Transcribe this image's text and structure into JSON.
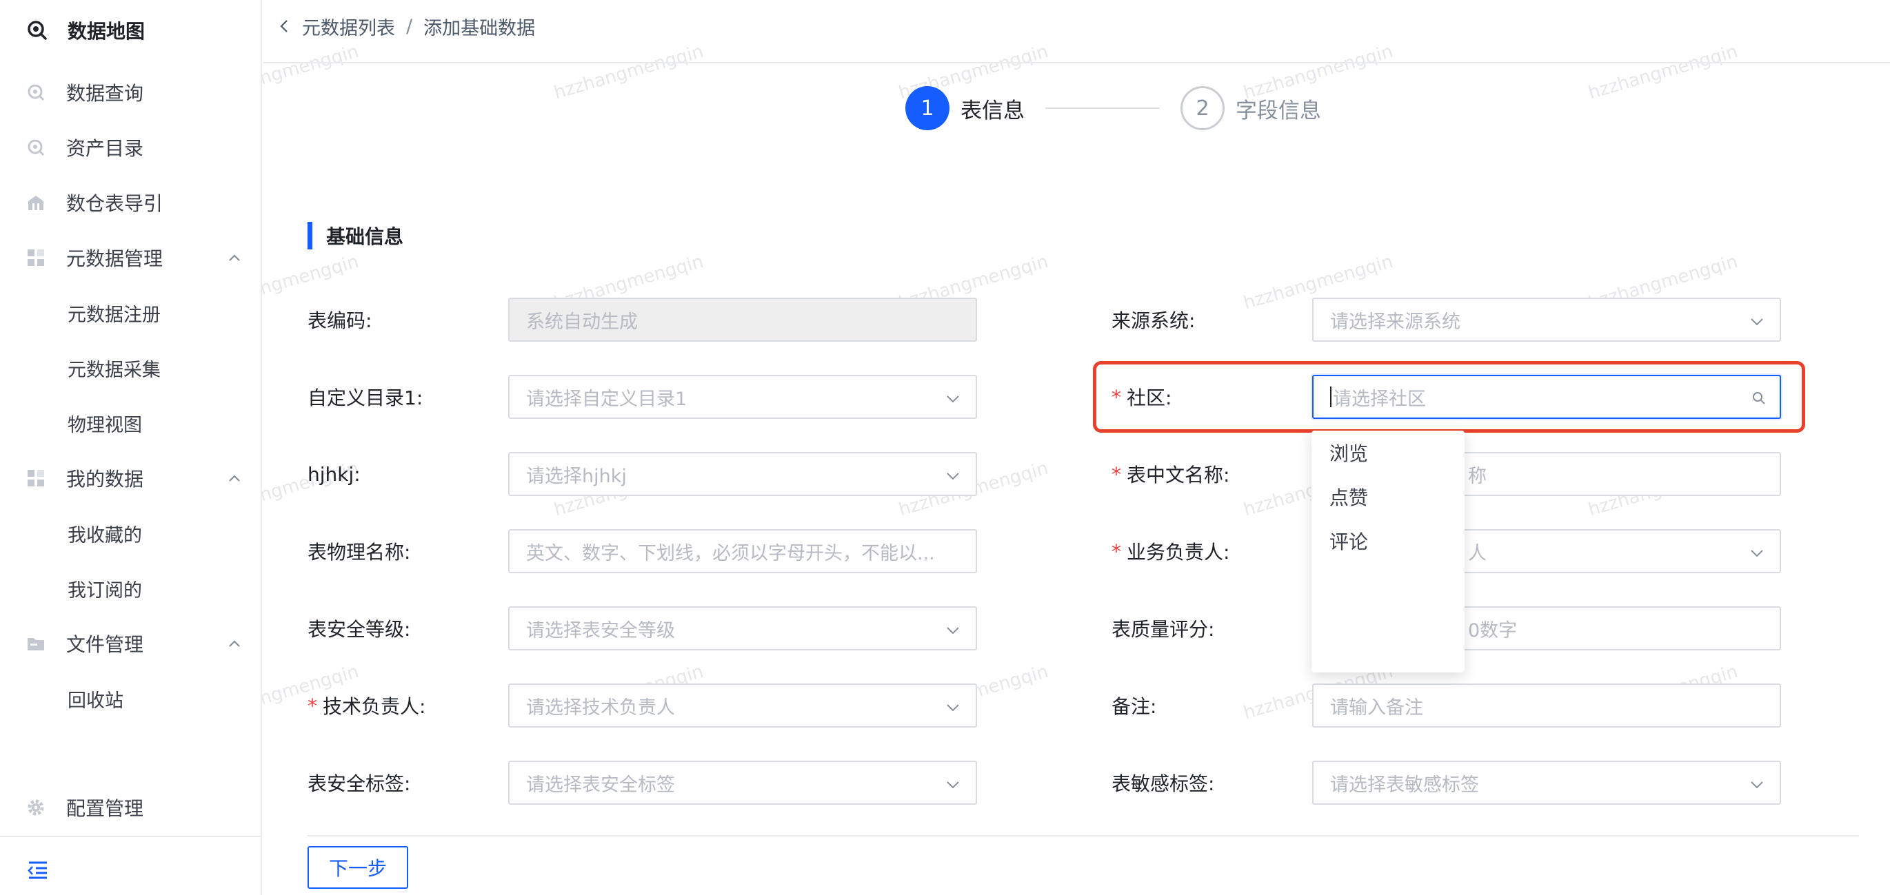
{
  "sidebar": {
    "logo_label": "数据地图",
    "items": [
      {
        "label": "数据查询",
        "icon": "search-data-icon"
      },
      {
        "label": "资产目录",
        "icon": "asset-catalog-icon"
      },
      {
        "label": "数仓表导引",
        "icon": "warehouse-icon"
      },
      {
        "label": "元数据管理",
        "icon": "grid-icon",
        "expanded": true,
        "children": [
          "元数据注册",
          "元数据采集",
          "物理视图"
        ]
      },
      {
        "label": "我的数据",
        "icon": "grid-icon",
        "expanded": true,
        "children": [
          "我收藏的",
          "我订阅的"
        ]
      },
      {
        "label": "文件管理",
        "icon": "folder-icon",
        "expanded": true,
        "children": [
          "回收站"
        ]
      }
    ],
    "config_label": "配置管理"
  },
  "breadcrumb": {
    "parent": "元数据列表",
    "separator": "/",
    "current": "添加基础数据"
  },
  "steps": [
    {
      "number": "1",
      "label": "表信息",
      "active": true
    },
    {
      "number": "2",
      "label": "字段信息",
      "active": false
    }
  ],
  "section_title": "基础信息",
  "form": {
    "table_code": {
      "label": "表编码:",
      "placeholder": "系统自动生成"
    },
    "source_system": {
      "label": "来源系统:",
      "placeholder": "请选择来源系统"
    },
    "custom_dir": {
      "label": "自定义目录1:",
      "placeholder": "请选择自定义目录1"
    },
    "community": {
      "label": "社区:",
      "required": "*",
      "placeholder": "请选择社区"
    },
    "hjhkj": {
      "label": "hjhkj:",
      "placeholder": "请选择hjhkj"
    },
    "cn_name": {
      "label": "表中文名称:",
      "required": "*",
      "placeholder_visible": "称"
    },
    "physical_name": {
      "label": "表物理名称:",
      "placeholder": "英文、数字、下划线，必须以字母开头，不能以..."
    },
    "biz_owner": {
      "label": "业务负责人:",
      "required": "*",
      "placeholder_visible": "人"
    },
    "security_level": {
      "label": "表安全等级:",
      "placeholder": "请选择表安全等级"
    },
    "quality_score": {
      "label": "表质量评分:",
      "placeholder_visible": "0数字"
    },
    "tech_owner": {
      "label": "技术负责人:",
      "required": "*",
      "placeholder": "请选择技术负责人"
    },
    "remark": {
      "label": "备注:",
      "placeholder": "请输入备注"
    },
    "security_tag": {
      "label": "表安全标签:",
      "placeholder": "请选择表安全标签"
    },
    "sensitive_tag": {
      "label": "表敏感标签:",
      "placeholder": "请选择表敏感标签"
    }
  },
  "community_dropdown": [
    "浏览",
    "点赞",
    "评论"
  ],
  "next_button": "下一步",
  "watermark": "hzzhangmengqin",
  "colors": {
    "primary": "#165dff",
    "required": "#f53f3f",
    "highlight": "#e8402c"
  }
}
